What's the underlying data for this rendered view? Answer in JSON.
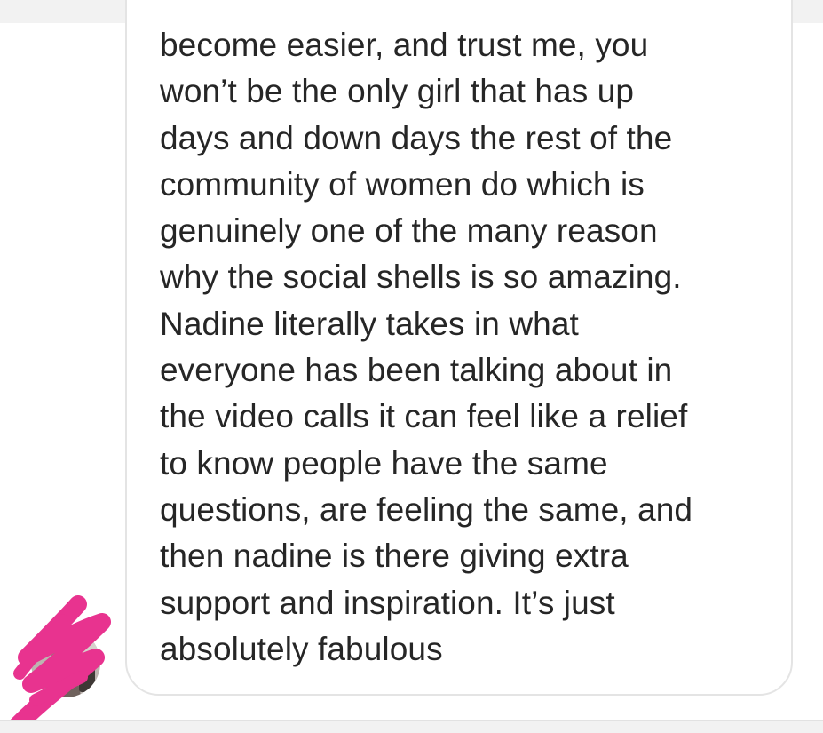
{
  "message": {
    "lines": [
      "become easier, and trust me, you",
      "won’t be the only girl that has up",
      "days and down days the rest of the",
      "community of women do which is",
      "genuinely one of the many reason",
      "why the social shells is so amazing.",
      "Nadine literally takes in what",
      "everyone has been talking about in",
      "the video calls it can feel like a relief",
      "to know people have the same",
      "questions, are feeling the same, and",
      "then nadine is there giving extra",
      "support and inspiration. It’s just",
      "absolutely fabulous"
    ]
  },
  "colors": {
    "text": "#262626",
    "bubble_border": "#e4e4e4",
    "scribble": "#e8338f"
  },
  "icons": {
    "avatar": "sender-profile-photo",
    "overlay": "pink-scribble-redaction"
  }
}
